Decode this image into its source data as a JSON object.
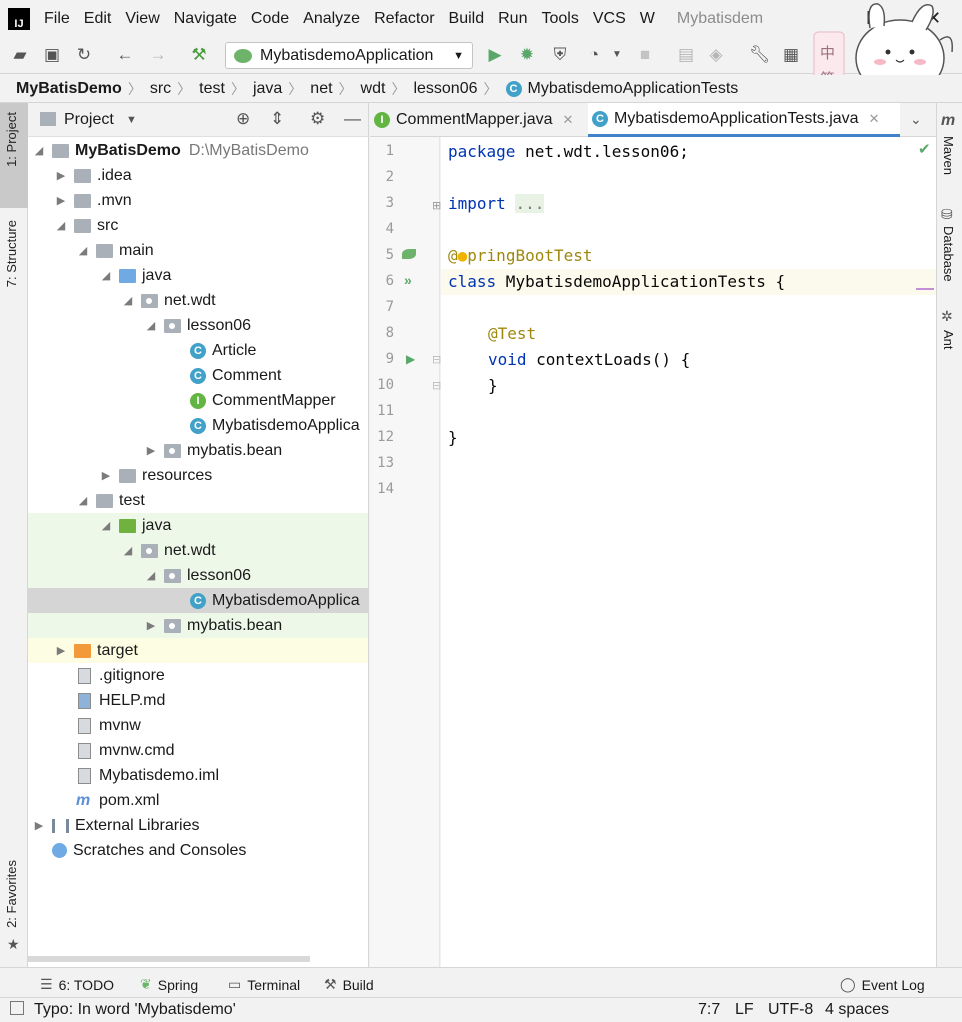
{
  "menu": {
    "items": [
      "File",
      "Edit",
      "View",
      "Navigate",
      "Code",
      "Analyze",
      "Refactor",
      "Build",
      "Run",
      "Tools",
      "VCS",
      "W"
    ],
    "window_title": "Mybatisdem"
  },
  "toolbar": {
    "run_config": "MybatisdemoApplication"
  },
  "breadcrumb": [
    "MyBatisDemo",
    "src",
    "test",
    "java",
    "net",
    "wdt",
    "lesson06",
    "MybatisdemoApplicationTests"
  ],
  "left_tabs": {
    "project": "1: Project",
    "structure": "7: Structure",
    "favorites": "2: Favorites"
  },
  "project_panel": {
    "title": "Project",
    "root_name": "MyBatisDemo",
    "root_path": "D:\\MyBatisDemo",
    "nodes": [
      ".idea",
      ".mvn",
      "src",
      "main",
      "java",
      "net.wdt",
      "lesson06",
      "Article",
      "Comment",
      "CommentMapper",
      "MybatisdemoApplica",
      "mybatis.bean",
      "resources",
      "test",
      "java",
      "net.wdt",
      "lesson06",
      "MybatisdemoApplica",
      "mybatis.bean",
      "target",
      ".gitignore",
      "HELP.md",
      "mvnw",
      "mvnw.cmd",
      "Mybatisdemo.iml",
      "pom.xml",
      "External Libraries",
      "Scratches and Consoles"
    ]
  },
  "editor": {
    "tabs": [
      "CommentMapper.java",
      "MybatisdemoApplicationTests.java"
    ],
    "line_numbers": [
      "1",
      "2",
      "3",
      "4",
      "5",
      "6",
      "7",
      "8",
      "9",
      "10",
      "11",
      "12",
      "13",
      "14"
    ],
    "code": {
      "l1_kw": "package",
      "l1_rest": " net.wdt.lesson06;",
      "l3_kw": "import",
      "l3_fold": "...",
      "l6_at": "@",
      "l6_ann": "pringBootTest",
      "l7_kw": "class",
      "l7_name": " MybatisdemoApplicationTests",
      "l7_brace": " {",
      "l9_ann": "@Test",
      "l10_kw": "void",
      "l10_rest": " contextLoads() {",
      "l11": "}",
      "l13": "}"
    }
  },
  "right_tabs": {
    "maven": "Maven",
    "database": "Database",
    "ant": "Ant"
  },
  "bottom_tools": {
    "todo": "6: TODO",
    "spring": "Spring",
    "terminal": "Terminal",
    "build": "Build",
    "event_log": "Event Log"
  },
  "status": {
    "message": "Typo: In word 'Mybatisdemo'",
    "position": "7:7",
    "line_sep": "LF",
    "encoding": "UTF-8",
    "indent": "4 spaces"
  },
  "colors": {
    "accent": "#4083c9",
    "keyword": "#0033b3",
    "annotation": "#9e880d",
    "run_green": "#59a869"
  }
}
